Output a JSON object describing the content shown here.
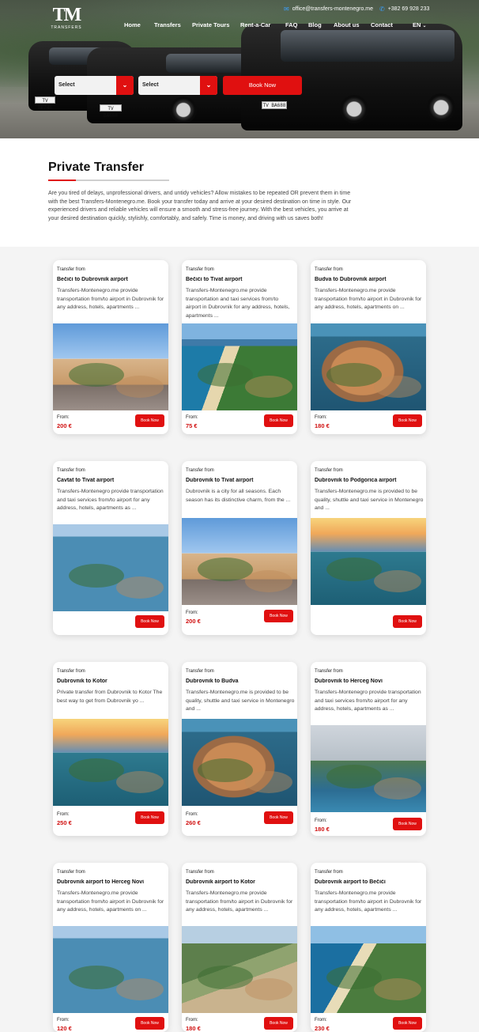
{
  "header": {
    "logo_text": "TM",
    "logo_sub": "TRANSFERS",
    "email": "office@transfers-montenegro.me",
    "phone": "+382 69 928 233",
    "nav": [
      "Home",
      "Transfers",
      "Private Tours",
      "Rent-a-Car",
      "FAQ",
      "Blog",
      "About us",
      "Contact"
    ],
    "language": "EN",
    "plates": [
      "TV BE748",
      "TV BA688",
      "TV BA688"
    ]
  },
  "booking": {
    "select1": "Select",
    "select2": "Select",
    "button": "Book Now"
  },
  "intro": {
    "title": "Private Transfer",
    "text": "Are you tired of delays, unprofessional drivers, and untidy vehicles? Allow mistakes to be repeated OR prevent them in time with the best Transfers-Montenegro.me. Book your transfer today and arrive at your desired destination on time in style. Our experienced drivers and reliable vehicles will ensure a smooth and stress-free journey. With the best vehicles, you arrive at your desired destination quickly, stylishly, comfortably, and safely. Time is money, and driving with us saves both!"
  },
  "card_labels": {
    "kicker": "Transfer from",
    "from": "From:",
    "button": "Book Now"
  },
  "cards": [
    {
      "title": "Bečići to Dubrovnik airport",
      "desc": "   Transfers-Montenegro.me provide transportation from/to airport in Dubrovnik for any address, hotels, apartments ...",
      "price": "200 €",
      "scene": "city"
    },
    {
      "title": "Bečići to Tivat airport",
      "desc": "   Transfers-Montenegro.me provide transportation and taxi services from/to airport in Dubrovnik for any address, hotels, apartments ...",
      "price": "75 €",
      "scene": "beach"
    },
    {
      "title": "Budva to Dubrovnik airport",
      "desc": "Transfers-Montenegro.me provide transportation from/to airport in Dubrovnik for any address, hotels, apartments on ...",
      "price": "180 €",
      "scene": "old"
    },
    {
      "title": "Cavtat to Tivat airport",
      "desc": "Transfers-Montenegro provide transportation and taxi services from/to airport for any address, hotels, apartments as ...",
      "price": "",
      "scene": "island"
    },
    {
      "title": "Dubrovnik to Tivat airport",
      "desc": "Dubrovnik is a city for all seasons. Each season has its distinctive charm, from the ...",
      "price": "200 €",
      "scene": "city"
    },
    {
      "title": "Dubrovnik to Podgorica airport",
      "desc": "   Transfers-Montenegro.me is provided to be quality, shuttle and taxi service in Montenegro and ...",
      "price": "",
      "scene": "sunset"
    },
    {
      "title": "Dubrovnik to Kotor",
      "desc": "Private transfer from Dubrovnik to Kotor The best way to get from Dubrovnik yo ...",
      "price": "250 €",
      "scene": "sunset"
    },
    {
      "title": "Dubrovnik to Budva",
      "desc": "   Transfers-Montenegro.me is provided to be quality, shuttle and taxi service in Montenegro and ...",
      "price": "260 €",
      "scene": "old"
    },
    {
      "title": "Dubrovnik to Herceg Novi",
      "desc": "Transfers-Montenegro provide transportation and taxi services from/to airport for any address, hotels, apartments as ...",
      "price": "180 €",
      "scene": "cloud"
    },
    {
      "title": "Dubrovnik airport to Herceg Novi",
      "desc": "Transfers-Montenegro.me provide transportation from/to airport in Dubrovnik for any address, hotels, apartments on ...",
      "price": "120 €",
      "scene": "island"
    },
    {
      "title": "Dubrovnik airport to Kotor",
      "desc": "   Transfers-Montenegro.me provide transportation from/to airport in Dubrovnik for any address, hotels, apartments ...",
      "price": "180 €",
      "scene": "mount"
    },
    {
      "title": "Dubrovnik airport to Bečići",
      "desc": "   Transfers-Montenegro.me provide transportation from/to airport in Dubrovnik for any address, hotels, apartments ...",
      "price": "230 €",
      "scene": "coast"
    }
  ],
  "colors": {
    "accent": "#e01010",
    "price": "#d01010",
    "page_bg": "#f4f4f4"
  }
}
